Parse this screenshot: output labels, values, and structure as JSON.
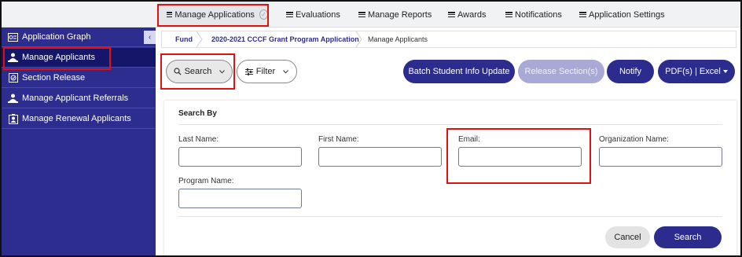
{
  "topnav": {
    "items": [
      {
        "label": "Manage Applications"
      },
      {
        "label": "Evaluations"
      },
      {
        "label": "Manage Reports"
      },
      {
        "label": "Awards"
      },
      {
        "label": "Notifications"
      },
      {
        "label": "Application Settings"
      }
    ]
  },
  "sidebar": {
    "items": [
      {
        "label": "Application Graph",
        "icon": "graph-icon"
      },
      {
        "label": "Manage Applicants",
        "icon": "applicants-icon"
      },
      {
        "label": "Section Release",
        "icon": "release-icon"
      },
      {
        "label": "Manage Applicant Referrals",
        "icon": "referrals-icon"
      },
      {
        "label": "Manage Renewal Applicants",
        "icon": "renewal-icon"
      }
    ],
    "collapse_glyph": "‹"
  },
  "breadcrumb": {
    "items": [
      {
        "label": "Fund"
      },
      {
        "label": "2020-2021 CCCF Grant Program Application"
      },
      {
        "label": "Manage Applicants"
      }
    ]
  },
  "toolbar": {
    "search_label": "Search",
    "filter_label": "Filter",
    "batch_label": "Batch Student Info Update",
    "release_label": "Release Section(s)",
    "notify_label": "Notify",
    "export_label": "PDF(s) | Excel"
  },
  "search_panel": {
    "title": "Search By",
    "fields": {
      "last_name": {
        "label": "Last Name:",
        "value": ""
      },
      "first_name": {
        "label": "First Name:",
        "value": ""
      },
      "email": {
        "label": "Email:",
        "value": ""
      },
      "organization_name": {
        "label": "Organization Name:",
        "value": ""
      },
      "program_name": {
        "label": "Program Name:",
        "value": ""
      }
    },
    "cancel_label": "Cancel",
    "search_label": "Search"
  },
  "colors": {
    "sidebar_bg": "#2d2d8f",
    "sidebar_active": "#15156a",
    "primary_button": "#2b2c8d",
    "disabled_button": "#a9a9d6",
    "highlight": "#e01111"
  }
}
